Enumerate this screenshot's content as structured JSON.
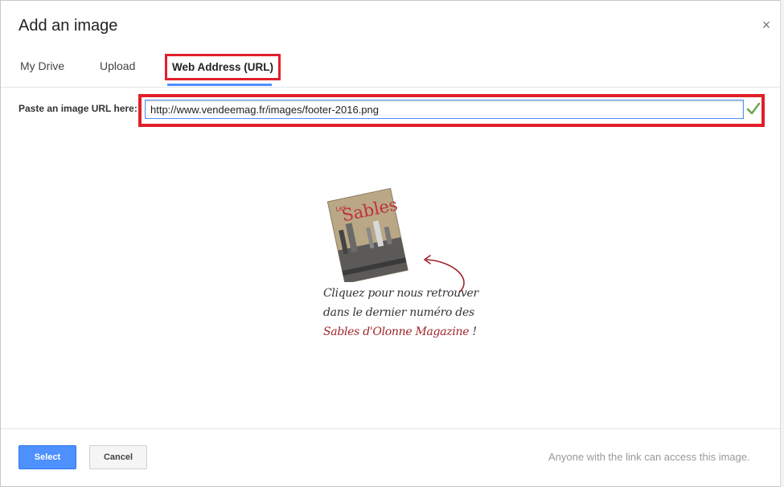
{
  "dialog": {
    "title": "Add an image",
    "close_glyph": "×"
  },
  "tabs": [
    {
      "label": "My Drive"
    },
    {
      "label": "Upload"
    },
    {
      "label": "Web Address (URL)",
      "active": true
    }
  ],
  "url": {
    "label": "Paste an image URL here:",
    "value": "http://www.vendeemag.fr/images/footer-2016.png"
  },
  "preview": {
    "line1": "Cliquez pour nous retrouver",
    "line2": "dans le dernier numéro des",
    "line3": "Sables d'Olonne Magazine",
    "line3_end": "!",
    "magazine_title": "Sables",
    "magazine_prefix": "Les"
  },
  "footer": {
    "select_label": "Select",
    "cancel_label": "Cancel",
    "note": "Anyone with the link can access this image."
  },
  "colors": {
    "accent": "#4d90fe",
    "highlight": "#e0202a",
    "valid_check": "#6aa84f",
    "promo_red": "#a0242c"
  },
  "icons": {
    "close": "close-icon",
    "check": "check-icon",
    "arrow": "curved-arrow-icon"
  }
}
